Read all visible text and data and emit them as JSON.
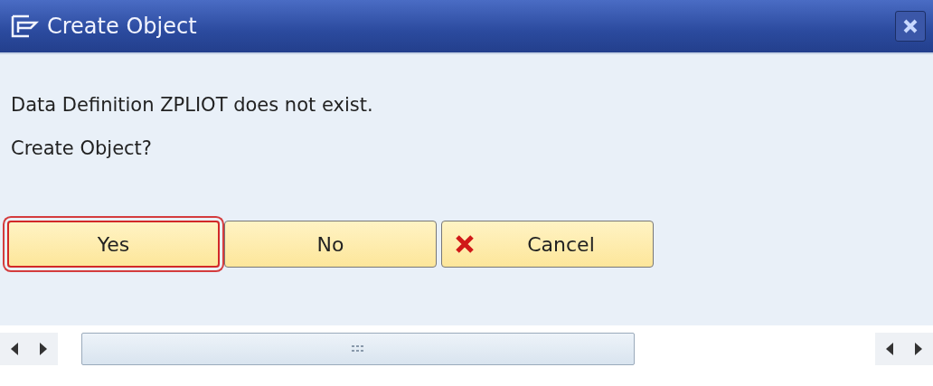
{
  "window": {
    "title": "Create Object"
  },
  "messages": [
    "Data Definition ZPLIOT does not exist.",
    "Create Object?"
  ],
  "buttons": [
    {
      "label": "Yes",
      "focused": true,
      "kind": "plain"
    },
    {
      "label": "No",
      "focused": false,
      "kind": "plain"
    },
    {
      "label": "Cancel",
      "focused": false,
      "kind": "cancel"
    }
  ]
}
